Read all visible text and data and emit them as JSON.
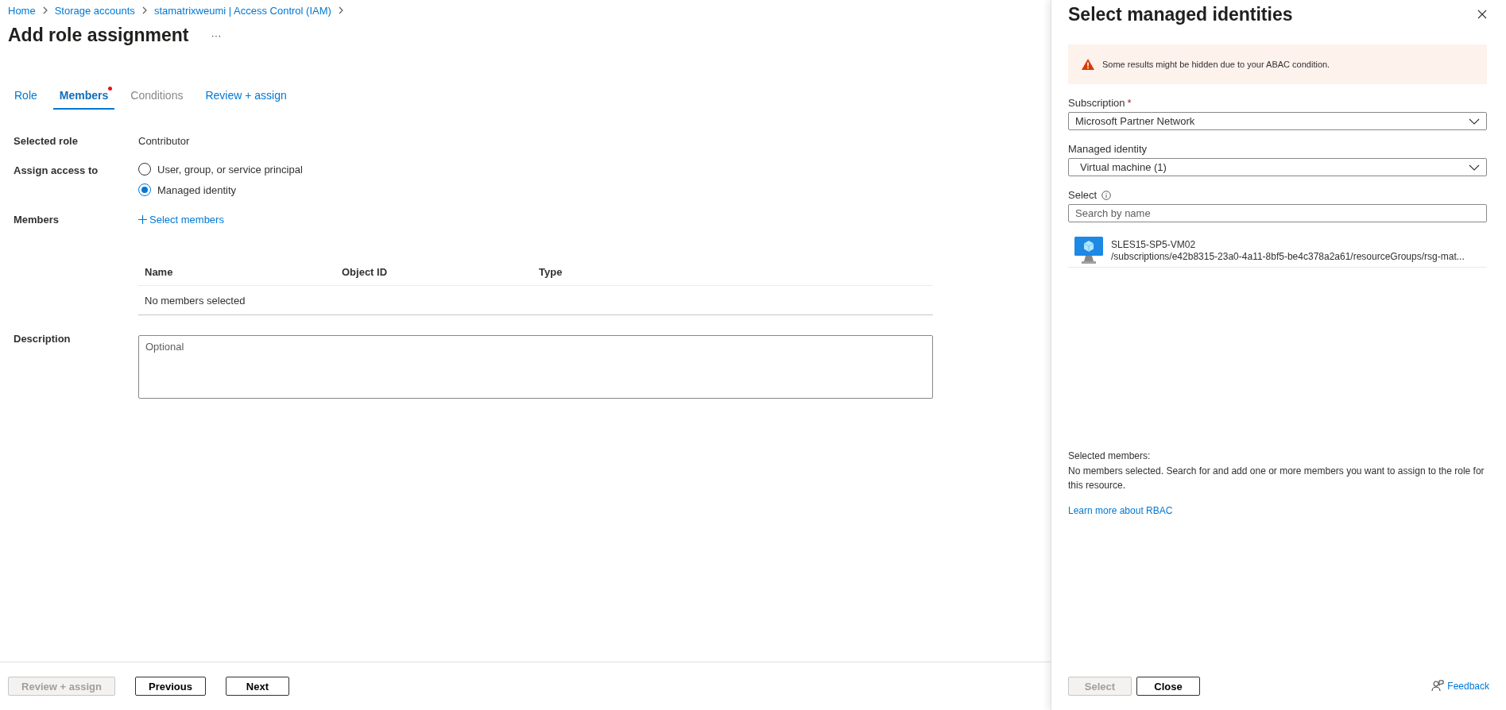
{
  "breadcrumb": [
    "Home",
    "Storage accounts",
    "stamatrixweumi | Access Control (IAM)"
  ],
  "page": {
    "title": "Add role assignment",
    "more": "···"
  },
  "tabs": [
    {
      "label": "Role",
      "selected": false,
      "disabled": false,
      "attention": false
    },
    {
      "label": "Members",
      "selected": true,
      "disabled": false,
      "attention": true
    },
    {
      "label": "Conditions",
      "selected": false,
      "disabled": true,
      "attention": false
    },
    {
      "label": "Review + assign",
      "selected": false,
      "disabled": false,
      "attention": false
    }
  ],
  "form": {
    "selected_role_label": "Selected role",
    "selected_role": "Contributor",
    "assign_label": "Assign access to",
    "assign_options": [
      {
        "label": "User, group, or service principal",
        "selected": false
      },
      {
        "label": "Managed identity",
        "selected": true
      }
    ],
    "members_label": "Members",
    "select_members": "Select members",
    "table": {
      "columns": [
        "Name",
        "Object ID",
        "Type"
      ],
      "empty": "No members selected"
    },
    "description_label": "Description",
    "description_placeholder": "Optional"
  },
  "footer": [
    {
      "label": "Review + assign",
      "disabled": true
    },
    {
      "label": "Previous",
      "disabled": false
    },
    {
      "label": "Next",
      "disabled": false
    }
  ],
  "panel": {
    "title": "Select managed identities",
    "warning": "Some results might be hidden due to your ABAC condition.",
    "subscription_label": "Subscription",
    "subscription_required_mark": "*",
    "subscription": "Microsoft Partner Network",
    "identity_label": "Managed identity",
    "identity": "Virtual machine (1)",
    "select_label": "Select",
    "search_placeholder": "Search by name",
    "results": [
      {
        "name": "SLES15-SP5-VM02",
        "path": "/subscriptions/e42b8315-23a0-4a11-8bf5-be4c378a2a61/resourceGroups/rsg-mat..."
      }
    ],
    "selected_members_label": "Selected members:",
    "selected_members_text": "No members selected. Search for and add one or more members you want to assign to the role for this resource.",
    "learn_more": "Learn more about RBAC",
    "buttons": [
      {
        "label": "Select",
        "disabled": true
      },
      {
        "label": "Close",
        "disabled": false
      }
    ],
    "feedback": "Feedback"
  }
}
